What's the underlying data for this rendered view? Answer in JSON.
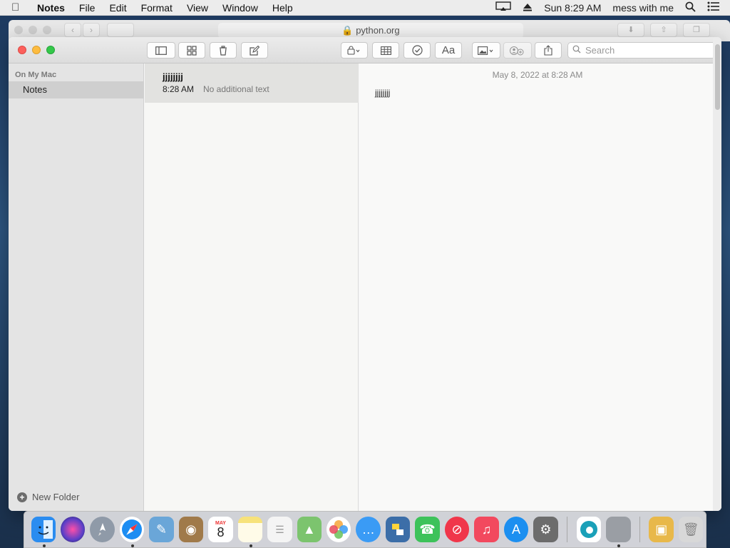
{
  "menubar": {
    "apple_icon": "apple-icon",
    "app_name": "Notes",
    "items": [
      "File",
      "Edit",
      "Format",
      "View",
      "Window",
      "Help"
    ],
    "clock": "Sun 8:29 AM",
    "user": "mess with me"
  },
  "safari": {
    "url": "python.org"
  },
  "toolbar": {
    "search_placeholder": "Search",
    "format_label": "Aa"
  },
  "sidebar": {
    "section_label": "On My Mac",
    "folder_label": "Notes",
    "new_folder_label": "New Folder"
  },
  "notes_list": {
    "items": [
      {
        "title": "jjjjjjjj",
        "time": "8:28 AM",
        "preview": "No additional text"
      }
    ]
  },
  "editor": {
    "date": "May 8, 2022 at 8:28 AM",
    "body": "jjjjjjjj"
  },
  "dock": {
    "calendar_month": "MAY",
    "calendar_day": "8",
    "apps": [
      {
        "name": "finder-icon",
        "color": "#2a8cf0"
      },
      {
        "name": "siri-icon",
        "color": "#5a3fc8"
      },
      {
        "name": "launchpad-icon",
        "color": "#8f9aa8"
      },
      {
        "name": "safari-icon",
        "color": "#1d8df2"
      },
      {
        "name": "preview-icon",
        "color": "#6aa6d8"
      },
      {
        "name": "contacts-icon",
        "color": "#a07a4a"
      },
      {
        "name": "calendar-icon",
        "color": "#ffffff"
      },
      {
        "name": "notes-icon",
        "color": "#f7e27a"
      },
      {
        "name": "reminders-icon",
        "color": "#f4f4f4"
      },
      {
        "name": "maps-icon",
        "color": "#7cc46e"
      },
      {
        "name": "photos-icon",
        "color": "#f6a53a"
      },
      {
        "name": "messages-icon",
        "color": "#3a9bf5"
      },
      {
        "name": "python-icon",
        "color": "#3c6ea8"
      },
      {
        "name": "facetime-icon",
        "color": "#3dc25a"
      },
      {
        "name": "news-icon",
        "color": "#f0364a"
      },
      {
        "name": "music-icon",
        "color": "#f2495e"
      },
      {
        "name": "app-store-icon",
        "color": "#1c8ff0"
      },
      {
        "name": "system-preferences-icon",
        "color": "#6c6c6c"
      },
      {
        "name": "edge-icon",
        "color": "#1aa0b8"
      },
      {
        "name": "disk-utility-icon",
        "color": "#9a9ea4"
      },
      {
        "name": "package-icon",
        "color": "#e8b84a"
      },
      {
        "name": "trash-icon",
        "color": "#d8d8d8"
      }
    ]
  }
}
